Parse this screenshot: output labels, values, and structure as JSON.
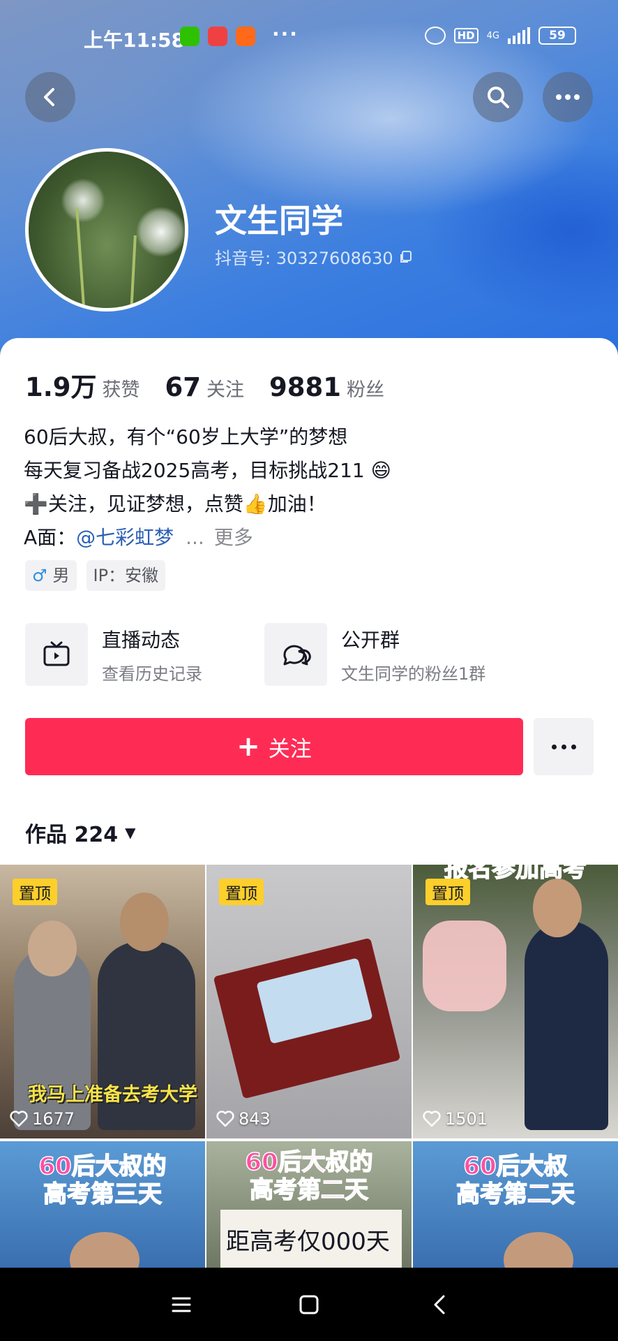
{
  "status_bar": {
    "time": "上午11:58",
    "dots": "···",
    "hd": "HD",
    "network": "4G",
    "battery": "59"
  },
  "profile": {
    "name": "文生同学",
    "douyin_id": "抖音号: 30327608630"
  },
  "stats": [
    {
      "value": "1.9万",
      "label": "获赞"
    },
    {
      "value": "67",
      "label": "关注"
    },
    {
      "value": "9881",
      "label": "粉丝"
    }
  ],
  "bio": {
    "line1": "60后大叔，有个“60岁上大学”的梦想",
    "line2": "每天复习备战2025高考，目标挑战211 😄",
    "line3": "➕关注，见证梦想，点赞👍加油！",
    "line4_prefix": "A面：",
    "mention": "@七彩虹梦",
    "ellipsis": "...",
    "more": "更多"
  },
  "tags": {
    "gender_symbol": "♂",
    "gender": "男",
    "ip": "IP：安徽"
  },
  "features": [
    {
      "title": "直播动态",
      "subtitle": "查看历史记录",
      "icon": "tv-icon"
    },
    {
      "title": "公开群",
      "subtitle": "文生同学的粉丝1群",
      "icon": "group-chat-icon"
    }
  ],
  "follow_button": {
    "plus": "+",
    "label": "关注"
  },
  "works": {
    "label": "作品 224",
    "arrow": "▼"
  },
  "videos": [
    {
      "pinned": "置顶",
      "likes": "1677",
      "caption": "我马上准备去考大学"
    },
    {
      "pinned": "置顶",
      "likes": "843"
    },
    {
      "pinned": "置顶",
      "likes": "1501",
      "overlay": "报名参加高考"
    },
    {
      "overlay": "60后大叔的\n高考第三天"
    },
    {
      "overlay": "60后大叔的\n高考第二天",
      "sign": "距高考仅000天"
    },
    {
      "overlay": "60后大叔\n高考第二天"
    }
  ],
  "colors": {
    "accent": "#fe2c55",
    "pin": "#fccf2b",
    "mention": "#2b5fb4",
    "overlay_text": "#ff4fa3"
  }
}
